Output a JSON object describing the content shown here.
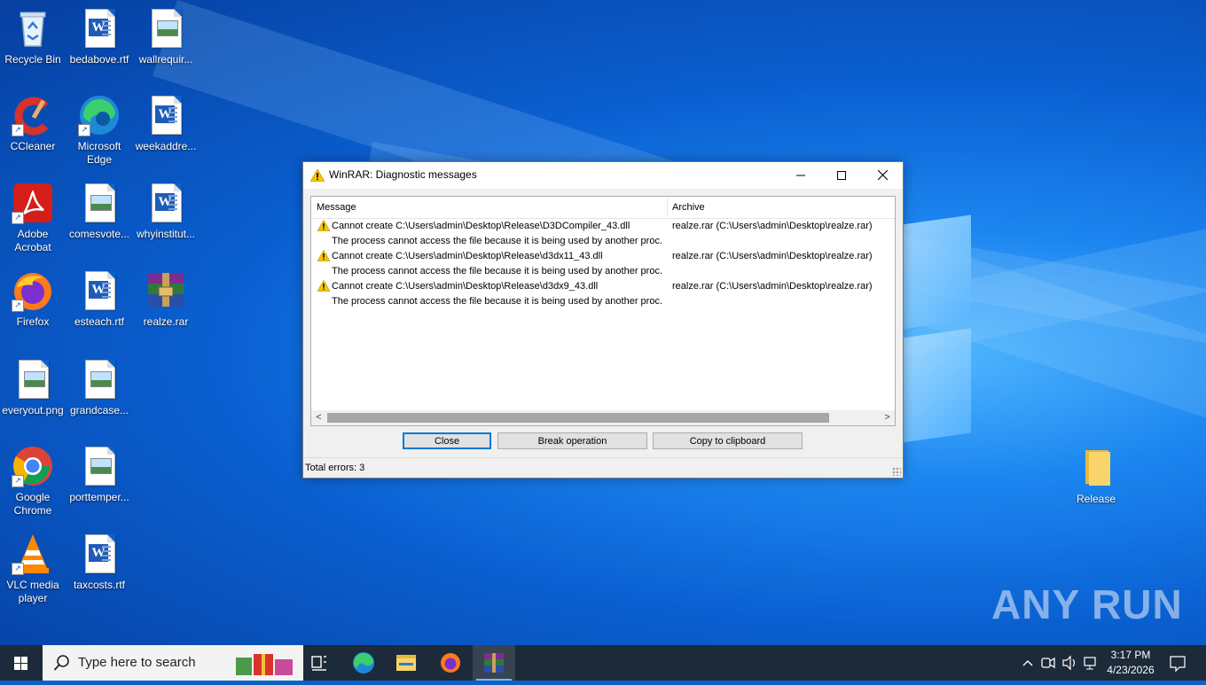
{
  "desktop": {
    "icons": [
      {
        "label": "Recycle Bin",
        "kind": "recycle-bin-icon"
      },
      {
        "label": "bedabove.rtf",
        "kind": "word-document-icon"
      },
      {
        "label": "wallrequir...",
        "kind": "image-file-icon"
      },
      {
        "label": "CCleaner",
        "kind": "ccleaner-icon"
      },
      {
        "label": "Microsoft Edge",
        "kind": "edge-icon"
      },
      {
        "label": "weekaddre...",
        "kind": "word-document-icon"
      },
      {
        "label": "Adobe Acrobat",
        "kind": "acrobat-icon"
      },
      {
        "label": "comesvote...",
        "kind": "image-file-icon"
      },
      {
        "label": "whyinstitut...",
        "kind": "word-document-icon"
      },
      {
        "label": "Firefox",
        "kind": "firefox-icon"
      },
      {
        "label": "esteach.rtf",
        "kind": "word-document-icon"
      },
      {
        "label": "realze.rar",
        "kind": "winrar-archive-icon"
      },
      {
        "label": "everyout.png",
        "kind": "image-file-icon"
      },
      {
        "label": "grandcase...",
        "kind": "image-file-icon"
      },
      {
        "label": "Google Chrome",
        "kind": "chrome-icon"
      },
      {
        "label": "porttemper...",
        "kind": "image-file-icon"
      },
      {
        "label": "VLC media player",
        "kind": "vlc-icon"
      },
      {
        "label": "taxcosts.rtf",
        "kind": "word-document-icon"
      },
      {
        "label": "Release",
        "kind": "folder-icon"
      }
    ]
  },
  "dialog": {
    "title": "WinRAR: Diagnostic messages",
    "columns": {
      "message": "Message",
      "archive": "Archive"
    },
    "rows": [
      {
        "message": "Cannot create C:\\Users\\admin\\Desktop\\Release\\D3DCompiler_43.dll",
        "archive": "realze.rar (C:\\Users\\admin\\Desktop\\realze.rar)",
        "warning": true
      },
      {
        "message": "The process cannot access the file because it is being used by another proc...",
        "archive": "",
        "warning": false
      },
      {
        "message": "Cannot create C:\\Users\\admin\\Desktop\\Release\\d3dx11_43.dll",
        "archive": "realze.rar (C:\\Users\\admin\\Desktop\\realze.rar)",
        "warning": true
      },
      {
        "message": "The process cannot access the file because it is being used by another proc...",
        "archive": "",
        "warning": false
      },
      {
        "message": "Cannot create C:\\Users\\admin\\Desktop\\Release\\d3dx9_43.dll",
        "archive": "realze.rar (C:\\Users\\admin\\Desktop\\realze.rar)",
        "warning": true
      },
      {
        "message": "The process cannot access the file because it is being used by another proc...",
        "archive": "",
        "warning": false
      }
    ],
    "buttons": {
      "close": "Close",
      "break": "Break operation",
      "copy": "Copy to clipboard"
    },
    "status": "Total errors: 3"
  },
  "watermark": "ANY RUN",
  "taskbar": {
    "search_placeholder": "Type here to search",
    "time": "3:17 PM",
    "date": "4/23/2026"
  },
  "colors": {
    "accent": "#0078d7",
    "taskbar": "#1c2a3a",
    "desktop": "#0a62c9",
    "warning": "#f7c600"
  }
}
